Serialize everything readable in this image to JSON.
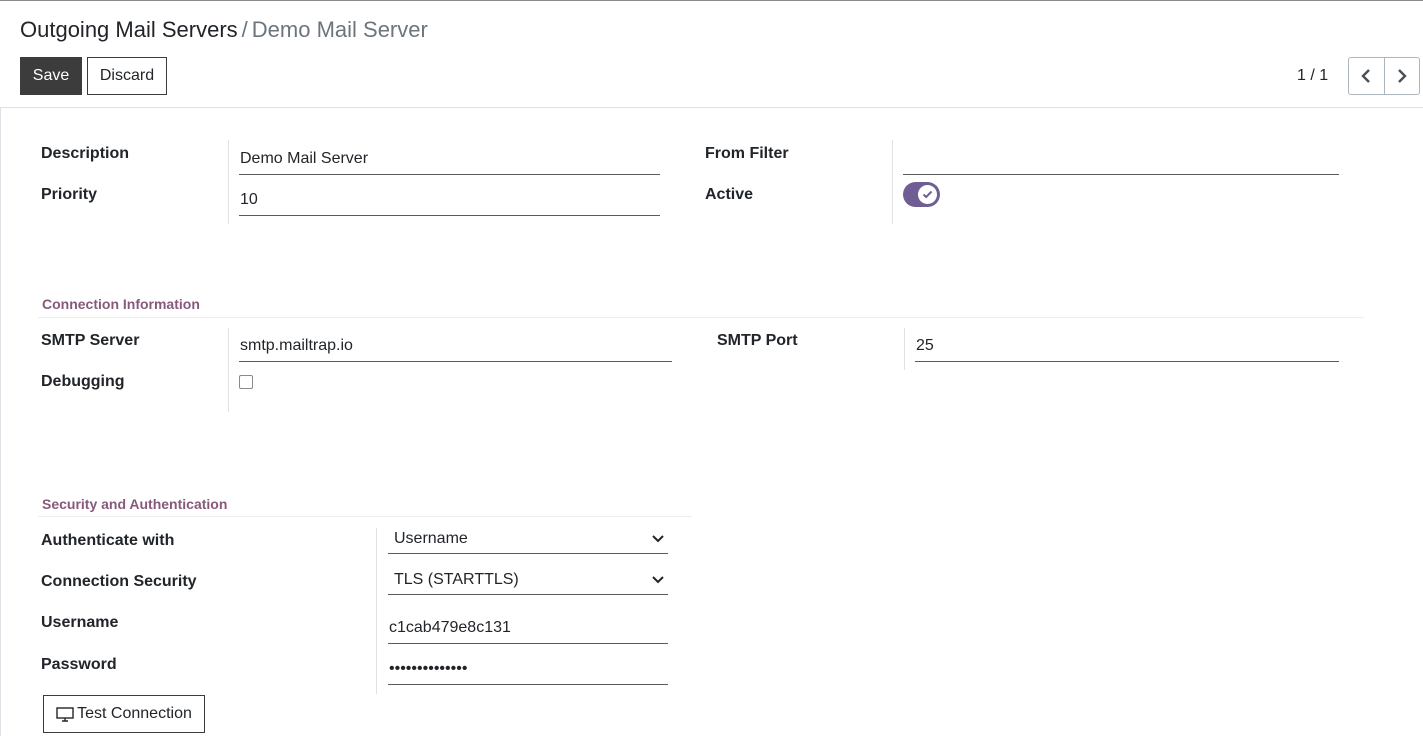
{
  "breadcrumb": {
    "parent": "Outgoing Mail Servers",
    "separator": "/",
    "current": "Demo Mail Server"
  },
  "toolbar": {
    "save_label": "Save",
    "discard_label": "Discard"
  },
  "pager": {
    "value": "1 / 1",
    "prev_icon": "chevron-left-icon",
    "next_icon": "chevron-right-icon"
  },
  "general": {
    "description_label": "Description",
    "description_value": "Demo Mail Server",
    "priority_label": "Priority",
    "priority_value": "10",
    "from_filter_label": "From Filter",
    "from_filter_value": "",
    "active_label": "Active",
    "active_value": true
  },
  "connection": {
    "title": "Connection Information",
    "smtp_server_label": "SMTP Server",
    "smtp_server_value": "smtp.mailtrap.io",
    "smtp_port_label": "SMTP Port",
    "smtp_port_value": "25",
    "debugging_label": "Debugging",
    "debugging_value": false
  },
  "security": {
    "title": "Security and Authentication",
    "authenticate_label": "Authenticate with",
    "authenticate_value": "Username",
    "connection_security_label": "Connection Security",
    "connection_security_value": "TLS (STARTTLS)",
    "username_label": "Username",
    "username_value": "c1cab479e8c131",
    "password_label": "Password",
    "password_value": "••••••••••••••"
  },
  "test_button": {
    "label": "Test Connection",
    "icon": "monitor-icon"
  },
  "colors": {
    "accent": "#875a7b",
    "toggle": "#6f5e93",
    "primary_button": "#3c3c3c"
  }
}
